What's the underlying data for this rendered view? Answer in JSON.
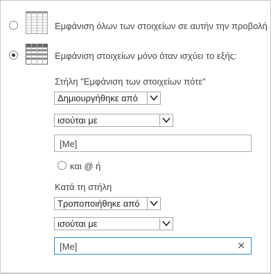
{
  "options": {
    "show_all_label": "Εμφάνιση όλων των στοιχείων σε αυτήν την προβολή",
    "show_filtered_label": "Εμφάνιση στοιχείων μόνο όταν ισχύει το εξής:",
    "show_all_selected": false,
    "show_filtered_selected": true
  },
  "filter1": {
    "heading": "Στήλη \"Εμφάνιση των στοιχείων πότε\"",
    "column_value": "Δημιουργήθηκε από",
    "operator_value": "ισούται με",
    "value_text": "[Me]"
  },
  "connector": {
    "label": "και @ ή"
  },
  "filter2": {
    "heading": "Κατά τη στήλη",
    "column_value": "Τροποποιήθηκε από",
    "operator_value": "ισούται με",
    "value_text": "[Me]",
    "clear_symbol": "✕"
  },
  "icons": {
    "show_all": "table-grid-icon",
    "show_filtered": "filtered-table-icon",
    "dropdown": "chevron-down-icon",
    "clear": "close-icon"
  }
}
